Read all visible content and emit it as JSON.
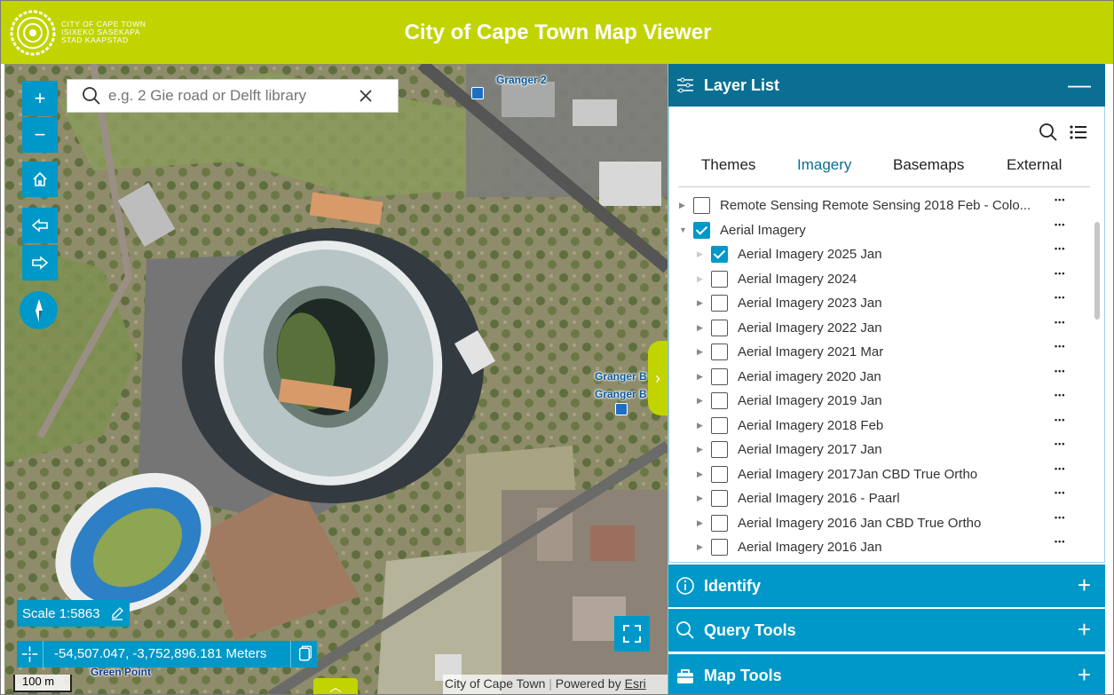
{
  "header": {
    "title": "City of Cape Town Map Viewer",
    "logo_line1": "CITY OF CAPE TOWN",
    "logo_line2": "ISIXEKO SASEKAPA",
    "logo_line3": "STAD KAAPSTAD",
    "brand_color": "#c2d400"
  },
  "map": {
    "search_placeholder": "e.g. 2 Gie road or Delft library",
    "scale_text": "Scale 1:5863",
    "coordinates": "-54,507.047, -3,752,896.181 Meters",
    "scalebar": "100 m",
    "attribution_source": "City of Cape Town",
    "attribution_powered": "Powered by",
    "attribution_esri": "Esri",
    "labels": {
      "granger2": "Granger 2",
      "grangerb1": "Granger B",
      "grangerb2": "Granger B",
      "greenpoint": "Green Point"
    },
    "controls": {
      "zoom_in": "+",
      "zoom_out": "−"
    },
    "accent_color": "#0098c9"
  },
  "panel": {
    "layer_list_title": "Layer List",
    "tabs": [
      "Themes",
      "Imagery",
      "Basemaps",
      "External"
    ],
    "active_tab": "Imagery",
    "layers": [
      {
        "label": "Remote Sensing Remote Sensing 2018 Feb - Colo...",
        "checked": false,
        "level": 0
      },
      {
        "label": "Aerial Imagery",
        "checked": true,
        "level": 0,
        "expanded": true
      },
      {
        "label": "Aerial Imagery 2025 Jan",
        "checked": true,
        "level": 1
      },
      {
        "label": "Aerial Imagery 2024",
        "checked": false,
        "level": 1
      },
      {
        "label": "Aerial Imagery 2023 Jan",
        "checked": false,
        "level": 1
      },
      {
        "label": "Aerial Imagery 2022 Jan",
        "checked": false,
        "level": 1
      },
      {
        "label": "Aerial Imagery 2021 Mar",
        "checked": false,
        "level": 1
      },
      {
        "label": "Aerial imagery 2020 Jan",
        "checked": false,
        "level": 1
      },
      {
        "label": "Aerial Imagery 2019 Jan",
        "checked": false,
        "level": 1
      },
      {
        "label": "Aerial Imagery 2018 Feb",
        "checked": false,
        "level": 1
      },
      {
        "label": "Aerial Imagery 2017 Jan",
        "checked": false,
        "level": 1
      },
      {
        "label": "Aerial Imagery 2017Jan CBD True Ortho",
        "checked": false,
        "level": 1
      },
      {
        "label": "Aerial Imagery 2016 - Paarl",
        "checked": false,
        "level": 1
      },
      {
        "label": "Aerial Imagery 2016 Jan CBD True Ortho",
        "checked": false,
        "level": 1
      },
      {
        "label": "Aerial Imagery 2016 Jan",
        "checked": false,
        "level": 1
      }
    ],
    "accordions": {
      "identify": "Identify",
      "query_tools": "Query Tools",
      "map_tools": "Map Tools"
    },
    "collapse_symbol": "—",
    "expand_symbol": "+"
  }
}
